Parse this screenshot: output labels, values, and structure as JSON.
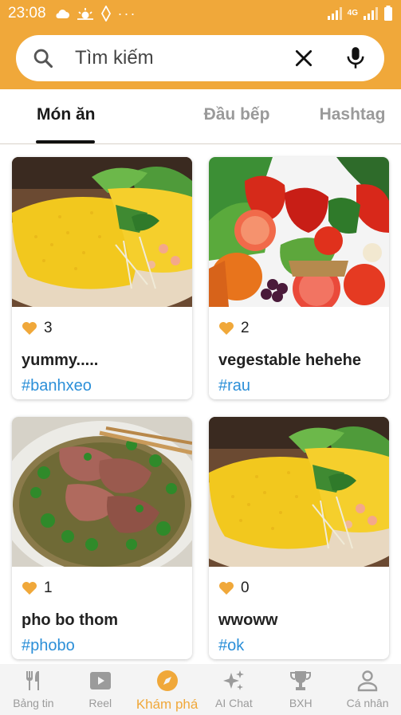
{
  "status_bar": {
    "time": "23:08",
    "network": "4G"
  },
  "search": {
    "placeholder": "Tìm kiếm"
  },
  "tabs": [
    {
      "label": "Món ăn",
      "active": true
    },
    {
      "label": "Đầu bếp",
      "active": false
    },
    {
      "label": "Hashtag",
      "active": false
    }
  ],
  "posts": [
    {
      "likes": "3",
      "title": "yummy.....",
      "tag": "#banhxeo",
      "image": "banh-xeo-photo"
    },
    {
      "likes": "2",
      "title": "vegestable hehehe",
      "tag": "#rau",
      "image": "vegetables-photo"
    },
    {
      "likes": "1",
      "title": "pho bo thom",
      "tag": "#phobo",
      "image": "pho-bo-photo"
    },
    {
      "likes": "0",
      "title": "wwoww",
      "tag": "#ok",
      "image": "banh-xeo-photo"
    }
  ],
  "bottom_nav": [
    {
      "label": "Bảng tin",
      "icon": "fork-knife-icon"
    },
    {
      "label": "Reel",
      "icon": "play-icon"
    },
    {
      "label": "Khám phá",
      "icon": "compass-icon",
      "active": true
    },
    {
      "label": "AI Chat",
      "icon": "sparkle-icon"
    },
    {
      "label": "BXH",
      "icon": "trophy-icon"
    },
    {
      "label": "Cá nhân",
      "icon": "person-icon"
    }
  ],
  "colors": {
    "accent": "#f0a83a",
    "hashtag": "#2b8fd8",
    "heart": "#f0a83a"
  }
}
